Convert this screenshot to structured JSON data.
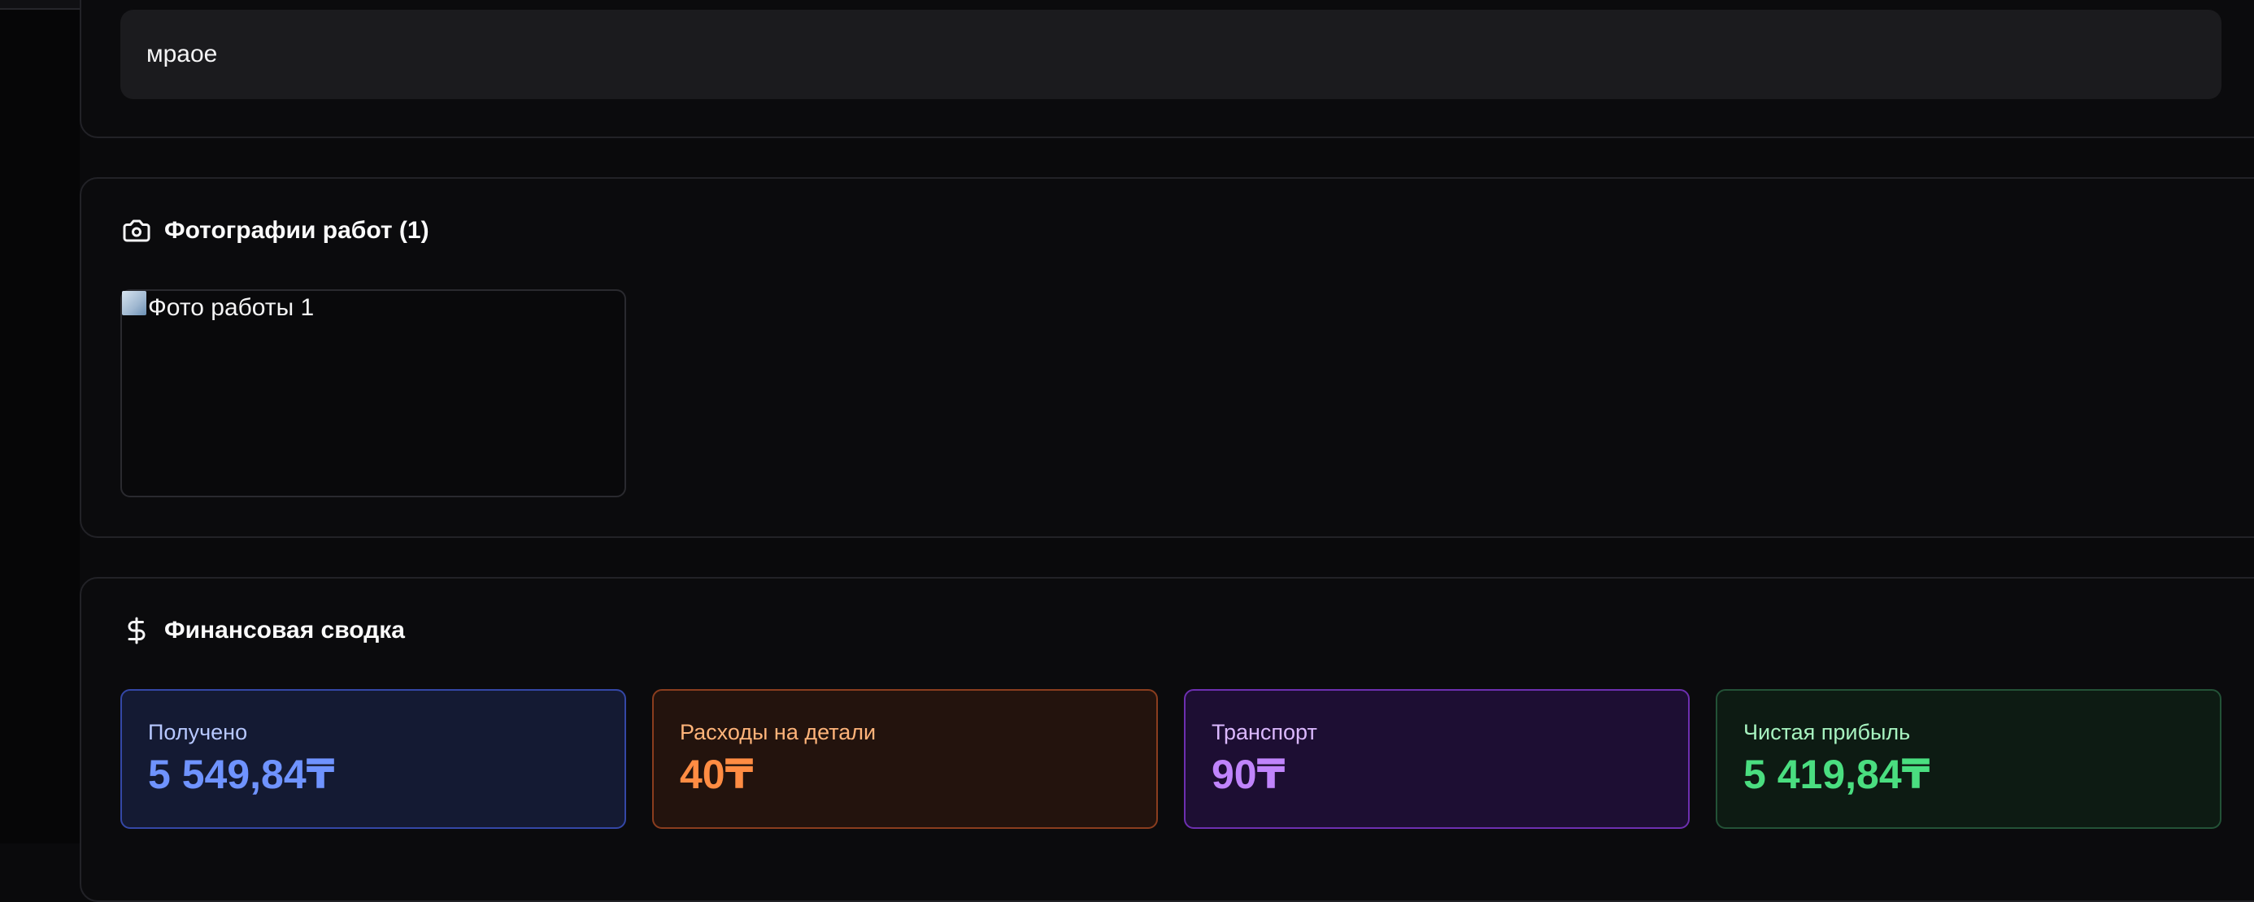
{
  "notes": {
    "text": "мраое"
  },
  "photos": {
    "title": "Фотографии работ (1)",
    "icon": "camera-icon",
    "items": [
      {
        "alt": "Фото работы 1"
      }
    ]
  },
  "finance": {
    "title": "Финансовая сводка",
    "icon": "dollar-icon",
    "stats": {
      "received": {
        "label": "Получено",
        "value": "5 549,84₸",
        "color": "#6f93ff"
      },
      "parts": {
        "label": "Расходы на детали",
        "value": "40₸",
        "color": "#ff8c43"
      },
      "transport": {
        "label": "Транспорт",
        "value": "90₸",
        "color": "#c084fc"
      },
      "profit": {
        "label": "Чистая прибыль",
        "value": "5 419,84₸",
        "color": "#4ade80"
      }
    }
  }
}
